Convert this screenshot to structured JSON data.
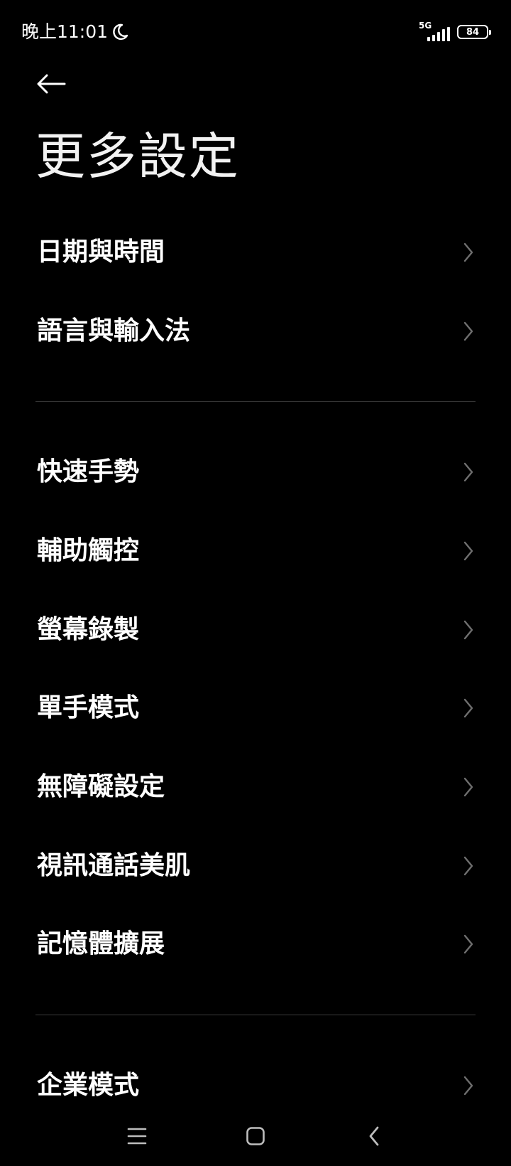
{
  "status_bar": {
    "time": "晚上11:01",
    "network": "5G",
    "battery": "84"
  },
  "header": {
    "title": "更多設定"
  },
  "sections": [
    {
      "items": [
        {
          "label": "日期與時間",
          "icon": "chevron-right-icon"
        },
        {
          "label": "語言與輸入法",
          "icon": "chevron-right-icon"
        }
      ]
    },
    {
      "items": [
        {
          "label": "快速手勢",
          "icon": "chevron-right-icon"
        },
        {
          "label": "輔助觸控",
          "icon": "chevron-right-icon"
        },
        {
          "label": "螢幕錄製",
          "icon": "chevron-right-icon"
        },
        {
          "label": "單手模式",
          "icon": "chevron-right-icon"
        },
        {
          "label": "無障礙設定",
          "icon": "chevron-right-icon"
        },
        {
          "label": "視訊通話美肌",
          "icon": "chevron-right-icon"
        },
        {
          "label": "記憶體擴展",
          "icon": "chevron-right-icon"
        }
      ]
    },
    {
      "items": [
        {
          "label": "企業模式",
          "icon": "chevron-right-icon"
        }
      ]
    }
  ],
  "nav_bar": {
    "buttons": [
      "menu-icon",
      "home-icon",
      "back-icon"
    ]
  },
  "colors": {
    "background": "#000000",
    "text": "#ffffff",
    "chevron": "#6f6f6f",
    "divider": "#3a3a3a"
  }
}
